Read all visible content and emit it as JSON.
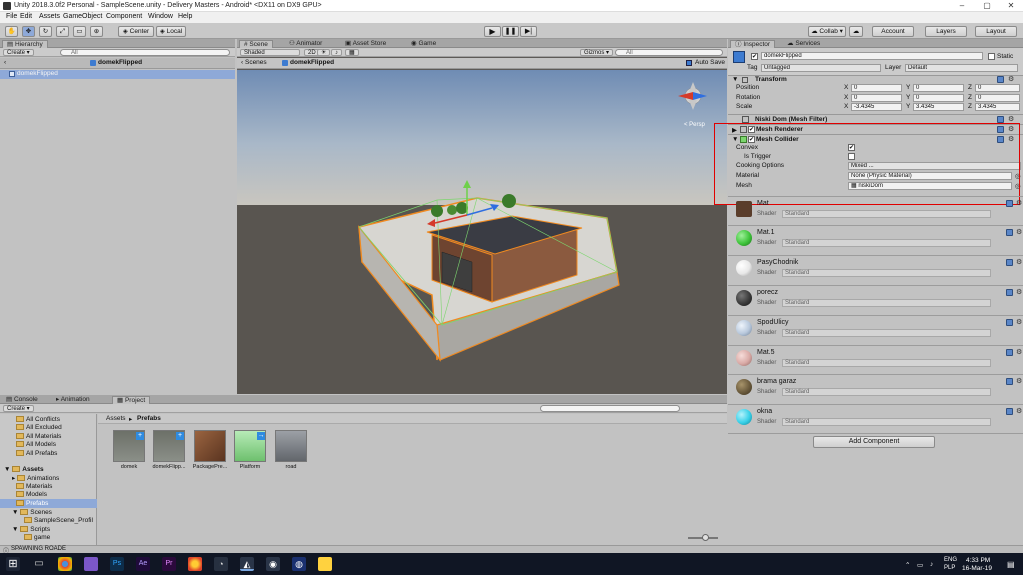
{
  "window": {
    "title": "Unity 2018.3.0f2 Personal - SampleScene.unity - Delivery Masters - Android* <DX11 on DX9 GPU>"
  },
  "menu": [
    "File",
    "Edit",
    "Assets",
    "GameObject",
    "Component",
    "Window",
    "Help"
  ],
  "toolbar": {
    "center": "Center",
    "local": "Local",
    "collab": "Collab ▾",
    "account": "Account",
    "layers": "Layers",
    "layout": "Layout"
  },
  "hierarchy": {
    "tab": "Hierarchy",
    "create": "Create ▾",
    "search_placeholder": "All",
    "scene_title": "domekFlipped",
    "item": "domekFlipped"
  },
  "scene": {
    "tabs": [
      "Scene",
      "Animator",
      "Asset Store",
      "Game"
    ],
    "shaded": "Shaded",
    "mode2d": "2D",
    "gizmos": "Gizmos ▾",
    "search_placeholder": "All",
    "crumb_scenes": "Scenes",
    "crumb_object": "domekFlipped",
    "autosave": "Auto Save",
    "persp": "< Persp"
  },
  "inspector": {
    "tabs": [
      "Inspector",
      "Services"
    ],
    "object_name": "domekFlipped",
    "static": "Static",
    "tag_label": "Tag",
    "tag_value": "Untagged",
    "layer_label": "Layer",
    "layer_value": "Default",
    "transform": {
      "header": "Transform",
      "rows": [
        {
          "label": "Position",
          "x": "0",
          "y": "0",
          "z": "0"
        },
        {
          "label": "Rotation",
          "x": "0",
          "y": "0",
          "z": "0"
        },
        {
          "label": "Scale",
          "x": "-3.4345",
          "y": "3.4345",
          "z": "3.4345"
        }
      ]
    },
    "mesh_filter": "Niski Dom (Mesh Filter)",
    "mesh_renderer": "Mesh Renderer",
    "mesh_collider": {
      "header": "Mesh Collider",
      "convex_label": "Convex",
      "convex_checked": true,
      "is_trigger_label": "Is Trigger",
      "is_trigger_checked": false,
      "cooking_label": "Cooking Options",
      "cooking_value": "Mixed ...",
      "material_label": "Material",
      "material_value": "None (Physic Material)",
      "mesh_label": "Mesh",
      "mesh_value": "niskiDom"
    },
    "materials": [
      {
        "name": "Mat",
        "shader": "Standard",
        "color": "#5a3d2b"
      },
      {
        "name": "Mat.1",
        "shader": "Standard",
        "color": "#3ec43a"
      },
      {
        "name": "PasyChodnik",
        "shader": "Standard",
        "color": "#e8e8e8"
      },
      {
        "name": "porecz",
        "shader": "Standard",
        "color": "#3a3a3a"
      },
      {
        "name": "SpodUlicy",
        "shader": "Standard",
        "color": "#b8c8dc"
      },
      {
        "name": "Mat.5",
        "shader": "Standard",
        "color": "#d9aaa6"
      },
      {
        "name": "brama garaz",
        "shader": "Standard",
        "color": "#6a5a3c"
      },
      {
        "name": "okna",
        "shader": "Standard",
        "color": "#37d0e8"
      }
    ],
    "shader_label": "Shader",
    "add_component": "Add Component"
  },
  "project": {
    "tabs": [
      "Console",
      "Animation",
      "Project"
    ],
    "create": "Create ▾",
    "favorites": [
      "All Conflicts",
      "All Excluded",
      "All Materials",
      "All Models",
      "All Prefabs"
    ],
    "assets_root": "Assets",
    "tree": [
      "Animations",
      "Materials",
      "Models",
      "Prefabs",
      "Scenes",
      "SampleScene_Profil",
      "Scripts",
      "game"
    ],
    "crumb_assets": "Assets",
    "crumb_sep": "▸",
    "crumb_prefabs": "Prefabs",
    "assets": [
      {
        "name": "domek",
        "color": "#8a8f88"
      },
      {
        "name": "domekFlipp...",
        "color": "#8a8f88"
      },
      {
        "name": "PackagePre...",
        "color": "#7a4a2a"
      },
      {
        "name": "Platform",
        "color": "#8ed58e"
      },
      {
        "name": "road",
        "color": "#7b7f85"
      }
    ]
  },
  "status": {
    "text": "SPAWNING ROADE"
  },
  "taskbar": {
    "lang1": "ENG",
    "lang2": "PLP",
    "time": "4:33 PM",
    "date": "16-Mar-19"
  },
  "colors": {
    "selection_box": "#e00000",
    "wire": "#f08a20",
    "collider": "#7cd66e"
  }
}
